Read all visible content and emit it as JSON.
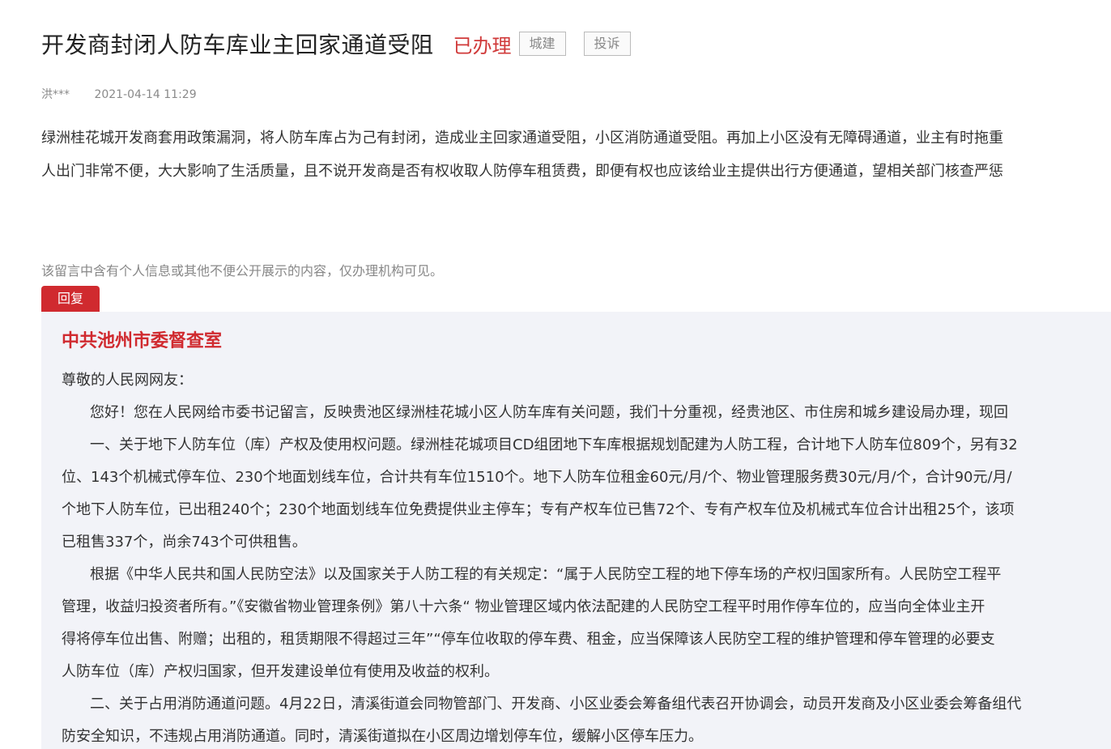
{
  "post": {
    "title": "开发商封闭人防车库业主回家通道受阻",
    "status": "已办理",
    "tags": [
      "城建",
      "投诉"
    ],
    "author": "洪***",
    "date": "2021-04-14 11:29",
    "content_lines": [
      "绿洲桂花城开发商套用政策漏洞，将人防车库占为己有封闭，造成业主回家通道受阻，小区消防通道受阻。再加上小区没有无障碍通道，业主有时拖重",
      "人出门非常不便，大大影响了生活质量，且不说开发商是否有权收取人防停车租赁费，即便有权也应该给业主提供出行方便通道，望相关部门核查严惩"
    ],
    "privacy_notice": "该留言中含有个人信息或其他不便公开展示的内容，仅办理机构可见。"
  },
  "reply": {
    "badge": "回复",
    "org": "中共池州市委督查室",
    "lines": [
      "尊敬的人民网网友：",
      "您好！您在人民网给市委书记留言，反映贵池区绿洲桂花城小区人防车库有关问题，我们十分重视，经贵池区、市住房和城乡建设局办理，现回",
      "一、关于地下人防车位（库）产权及使用权问题。绿洲桂花城项目CD组团地下车库根据规划配建为人防工程，合计地下人防车位809个，另有32",
      "位、143个机械式停车位、230个地面划线车位，合计共有车位1510个。地下人防车位租金60元/月/个、物业管理服务费30元/月/个，合计90元/月/",
      "个地下人防车位，已出租240个；230个地面划线车位免费提供业主停车；专有产权车位已售72个、专有产权车位及机械式车位合计出租25个，该项",
      "已租售337个，尚余743个可供租售。",
      "根据《中华人民共和国人民防空法》以及国家关于人防工程的有关规定：“属于人民防空工程的地下停车场的产权归国家所有。人民防空工程平",
      "管理，收益归投资者所有。”《安徽省物业管理条例》第八十六条“ 物业管理区域内依法配建的人民防空工程平时用作停车位的，应当向全体业主开",
      "得将停车位出售、附赠；出租的，租赁期限不得超过三年”“停车位收取的停车费、租金，应当保障该人民防空工程的维护管理和停车管理的必要支",
      "人防车位（库）产权归国家，但开发建设单位有使用及收益的权利。",
      "二、关于占用消防通道问题。4月22日，清溪街道会同物管部门、开发商、小区业委会筹备组代表召开协调会，动员开发商及小区业委会筹备组代",
      "防安全知识，不违规占用消防通道。同时，清溪街道拟在小区周边增划停车位，缓解小区停车压力。"
    ]
  }
}
